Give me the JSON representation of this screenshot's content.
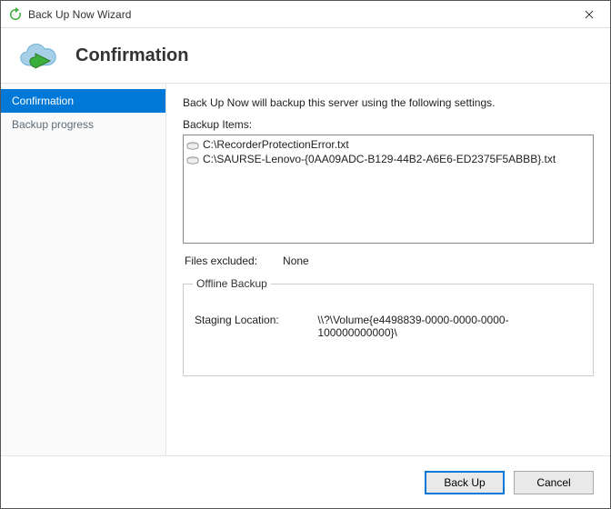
{
  "window": {
    "title": "Back Up Now Wizard"
  },
  "header": {
    "heading": "Confirmation"
  },
  "sidebar": {
    "items": [
      {
        "label": "Confirmation",
        "active": true
      },
      {
        "label": "Backup progress",
        "active": false
      }
    ]
  },
  "main": {
    "intro": "Back Up Now will backup this server using the following settings.",
    "items_label": "Backup Items:",
    "items": [
      "C:\\RecorderProtectionError.txt",
      "C:\\SAURSE-Lenovo-{0AA09ADC-B129-44B2-A6E6-ED2375F5ABBB}.txt"
    ],
    "excluded_label": "Files excluded:",
    "excluded_value": "None",
    "offline": {
      "legend": "Offline Backup",
      "staging_label": "Staging Location:",
      "staging_value": "\\\\?\\Volume{e4498839-0000-0000-0000-100000000000}\\"
    }
  },
  "footer": {
    "primary": "Back Up",
    "cancel": "Cancel"
  },
  "icons": {
    "title_icon": "refresh-icon",
    "header_icon": "cloud-backup-icon",
    "item_icon": "disk-icon",
    "close": "close-icon"
  }
}
